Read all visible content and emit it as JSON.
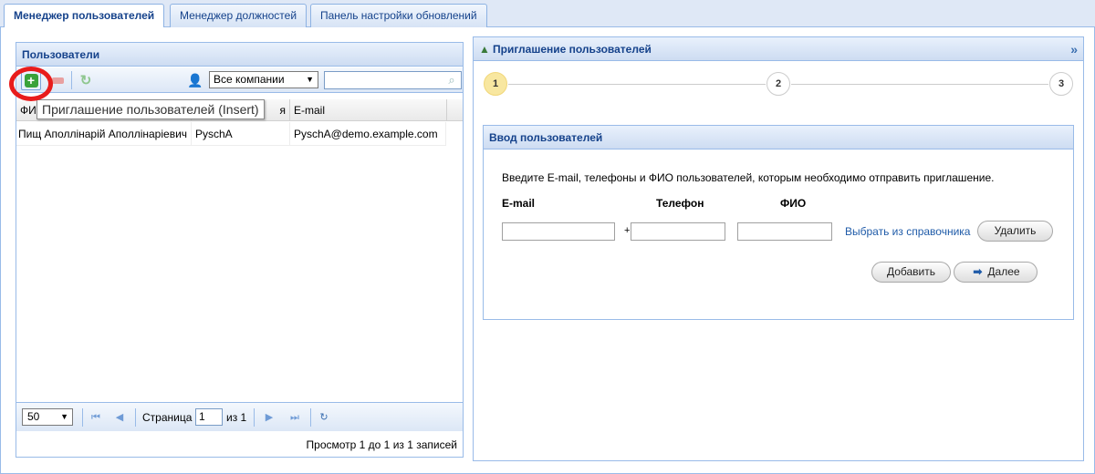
{
  "tabs": [
    {
      "label": "Менеджер пользователей",
      "active": true
    },
    {
      "label": "Менеджер должностей",
      "active": false
    },
    {
      "label": "Панель настройки обновлений",
      "active": false
    }
  ],
  "left_panel": {
    "title": "Пользователи",
    "company_select": {
      "value": "Все компании"
    },
    "search": {
      "value": ""
    },
    "tooltip": "Приглашение пользователей (Insert)",
    "columns": [
      "ФИ",
      "я",
      "E-mail"
    ],
    "rows": [
      {
        "name": "Пищ Аполлінарій Аполлінаріевич",
        "login": "PyschA",
        "email": "PyschA@demo.example.com"
      }
    ],
    "paging": {
      "page_size": "50",
      "page_label": "Страница",
      "page_value": "1",
      "of_label": "из 1",
      "summary": "Просмотр 1 до 1 из 1 записей"
    }
  },
  "right_panel": {
    "title": "Приглашение пользователей",
    "collapse_icon": "»",
    "steps": [
      "1",
      "2",
      "3"
    ],
    "active_step": 1,
    "subpanel": {
      "title": "Ввод пользователей",
      "description": "Введите E-mail, телефоны и ФИО пользователей, которым необходимо отправить приглашение.",
      "labels": {
        "email": "E-mail",
        "phone": "Телефон",
        "fio": "ФИО"
      },
      "phone_prefix": "+",
      "directory_link": "Выбрать из справочника",
      "delete_button": "Удалить",
      "add_button": "Добавить",
      "next_button": "Далее"
    }
  },
  "colors": {
    "accent_border": "#99bbe8",
    "header_text": "#15428b",
    "highlight_circle": "#e81c1c",
    "active_step": "#f8e7a0"
  },
  "icons": {
    "add": "add-icon",
    "remove": "remove-icon",
    "refresh": "refresh-icon",
    "search": "search-icon",
    "user_mail": "user-mail-icon",
    "next": "arrow-right-icon"
  }
}
